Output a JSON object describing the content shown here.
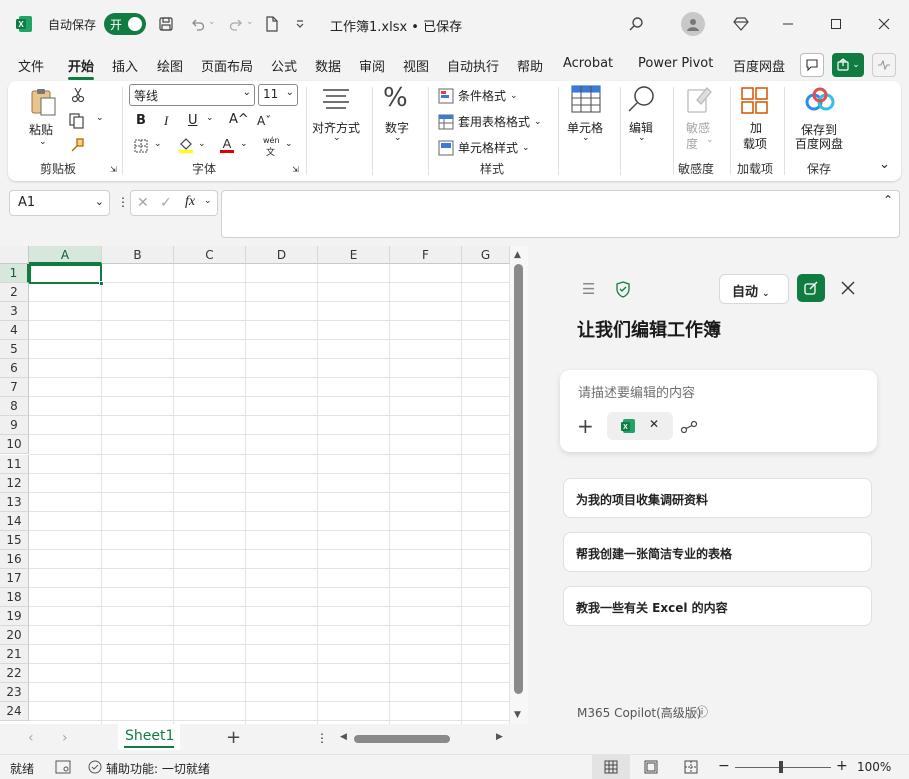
{
  "titlebar": {
    "autosave_label": "自动保存",
    "autosave_toggle": "开",
    "file_title": "工作簿1.xlsx • 已保存"
  },
  "tabs": [
    "文件",
    "开始",
    "插入",
    "绘图",
    "页面布局",
    "公式",
    "数据",
    "审阅",
    "视图",
    "自动执行",
    "帮助",
    "Acrobat",
    "Power Pivot",
    "百度网盘"
  ],
  "active_tab": "开始",
  "ribbon": {
    "clipboard": {
      "paste": "粘贴",
      "group": "剪贴板"
    },
    "font": {
      "name": "等线",
      "size": "11",
      "group": "字体",
      "bold": "B",
      "italic": "I",
      "underline": "U",
      "grow": "A^",
      "shrink": "Aˇ",
      "phonetic_top": "wén",
      "phonetic_bottom": "文"
    },
    "alignment": {
      "label": "对齐方式"
    },
    "number": {
      "label": "数字"
    },
    "styles": {
      "conditional": "条件格式",
      "table": "套用表格格式",
      "cell": "单元格样式",
      "group": "样式"
    },
    "cells": {
      "label": "单元格"
    },
    "editing": {
      "label": "编辑"
    },
    "sensitivity": {
      "label1": "敏感",
      "label2": "度",
      "group": "敏感度"
    },
    "addins": {
      "label1": "加",
      "label2": "载项",
      "group": "加载项"
    },
    "save": {
      "label1": "保存到",
      "label2": "百度网盘",
      "group": "保存"
    }
  },
  "formula": {
    "namebox": "A1",
    "fx": "fx"
  },
  "grid": {
    "columns": [
      "A",
      "B",
      "C",
      "D",
      "E",
      "F",
      "G"
    ],
    "rows": [
      "1",
      "2",
      "3",
      "4",
      "5",
      "6",
      "7",
      "8",
      "9",
      "10",
      "11",
      "12",
      "13",
      "14",
      "15",
      "16",
      "17",
      "18",
      "19",
      "20",
      "21",
      "22",
      "23",
      "24"
    ],
    "selected_cell": "A1"
  },
  "sheets": {
    "active": "Sheet1"
  },
  "copilot": {
    "mode": "自动",
    "heading": "让我们编辑工作簿",
    "placeholder": "请描述要编辑的内容",
    "suggestions": [
      "为我的项目收集调研资料",
      "帮我创建一张简洁专业的表格",
      "教我一些有关 Excel 的内容"
    ],
    "footer": "M365 Copilot(高级版)"
  },
  "status": {
    "ready": "就绪",
    "accessibility": "辅助功能: 一切就绪",
    "zoom": "100%"
  },
  "colors": {
    "brand": "#107c41",
    "selection": "#107c41"
  }
}
